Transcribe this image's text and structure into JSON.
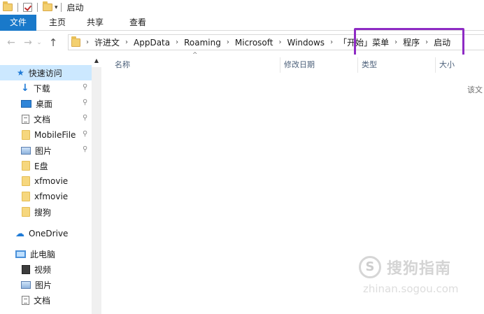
{
  "window": {
    "title": "启动"
  },
  "ribbon": {
    "tabs": [
      "文件",
      "主页",
      "共享",
      "查看"
    ],
    "accent": "#1979ca"
  },
  "nav": {
    "back_icon": "←",
    "forward_icon": "→",
    "recent_icon": "⌄",
    "up_icon": "↑"
  },
  "address": {
    "crumbs": [
      "许进文",
      "AppData",
      "Roaming",
      "Microsoft",
      "Windows",
      "「开始」菜单",
      "程序",
      "启动"
    ],
    "separator": "›",
    "highlight_color": "#8e2bc4"
  },
  "sidebar": {
    "items": [
      {
        "label": "快速访问",
        "icon": "star-icon",
        "pinned": false
      },
      {
        "label": "下载",
        "icon": "download-icon",
        "pinned": true
      },
      {
        "label": "桌面",
        "icon": "desktop-icon",
        "pinned": true
      },
      {
        "label": "文档",
        "icon": "document-icon",
        "pinned": true
      },
      {
        "label": "MobileFile",
        "icon": "folder-icon",
        "pinned": true
      },
      {
        "label": "图片",
        "icon": "pictures-icon",
        "pinned": true
      },
      {
        "label": "E盘",
        "icon": "folder-icon",
        "pinned": false
      },
      {
        "label": "xfmovie",
        "icon": "folder-icon",
        "pinned": false
      },
      {
        "label": "xfmovie",
        "icon": "folder-icon",
        "pinned": false
      },
      {
        "label": "搜狗",
        "icon": "folder-icon",
        "pinned": false
      },
      {
        "label": "OneDrive",
        "icon": "cloud-icon",
        "pinned": false
      },
      {
        "label": "此电脑",
        "icon": "computer-icon",
        "pinned": false
      },
      {
        "label": "视频",
        "icon": "video-icon",
        "pinned": false
      },
      {
        "label": "图片",
        "icon": "pictures-icon",
        "pinned": false
      },
      {
        "label": "文档",
        "icon": "document-icon",
        "pinned": false
      }
    ],
    "pin_icon": "📌"
  },
  "content": {
    "columns": [
      "名称",
      "修改日期",
      "类型",
      "大小"
    ],
    "empty_message": "该文",
    "sort_icon": "^"
  },
  "watermark": {
    "logo": "S",
    "text": "搜狗指南",
    "url": "zhinan.sogou.com"
  }
}
